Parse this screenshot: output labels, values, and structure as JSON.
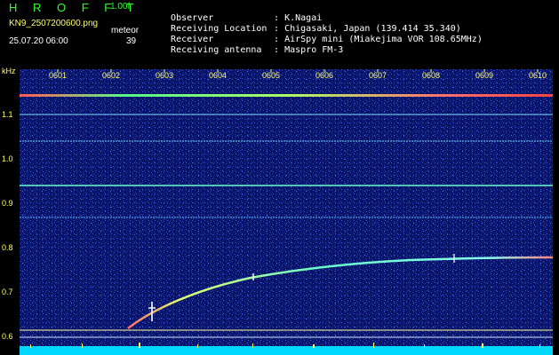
{
  "header": {
    "brand": "H R O F F T",
    "version": "1.00f",
    "filename": "KN9_2507200600.png",
    "meteor_label": "meteor",
    "meteor_count": "39",
    "timestamp": "25.07.20 06:00"
  },
  "info": [
    {
      "key": "Observer",
      "value": ": K.Nagai"
    },
    {
      "key": "Receiving Location",
      "value": ": Chigasaki, Japan (139.414 35.340)"
    },
    {
      "key": "Receiver",
      "value": ": AirSpy mini (Miakejima VOR 108.65MHz)"
    },
    {
      "key": "Receiving antenna",
      "value": ": Maspro FM-3"
    }
  ],
  "axis": {
    "y_unit": "kHz",
    "y_ticks": [
      "1.1",
      "1.0",
      "0.9",
      "0.8",
      "0.7",
      "0.6"
    ],
    "x_ticks": [
      "0601",
      "0602",
      "0603",
      "0604",
      "0605",
      "0606",
      "0607",
      "0608",
      "0609",
      "0610"
    ]
  },
  "colors": {
    "background": "#000000",
    "plot_bg": "#0a1466",
    "text_green": "#2cff2c",
    "text_yellow": "#ffff66",
    "text_white": "#ffffff"
  }
}
